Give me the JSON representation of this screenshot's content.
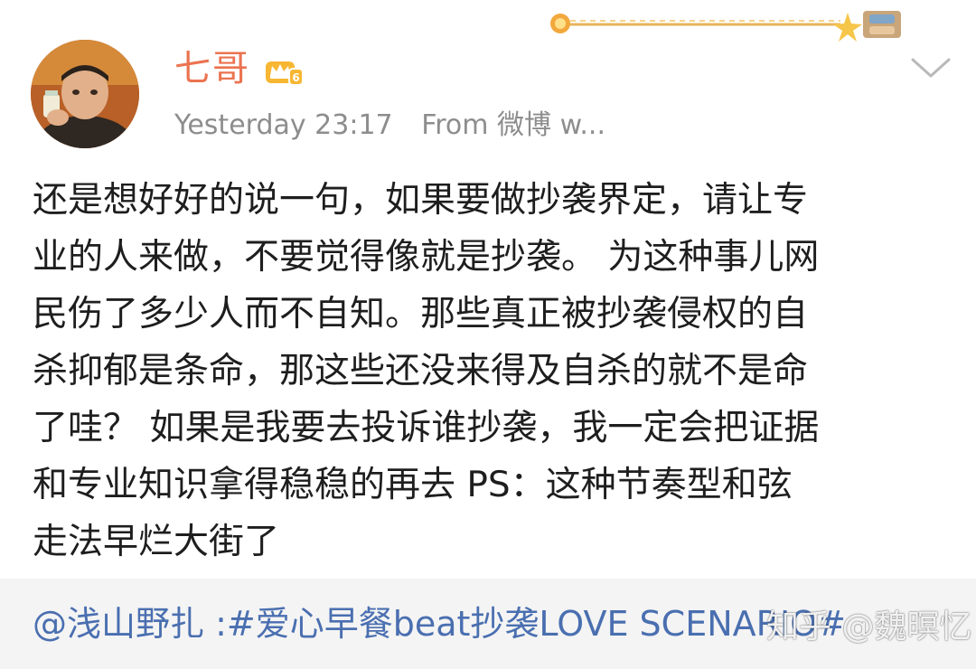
{
  "post": {
    "username": "七哥",
    "time": "Yesterday 23:17",
    "source": "From 微博 w...",
    "body": "还是想好好的说一句，如果要做抄袭界定，请让专\n业的人来做，不要觉得像就是抄袭。 为这种事儿网\n民伤了多少人而不自知。那些真正被抄袭侵权的自\n杀抑郁是条命，那这些还没来得及自杀的就不是命\n了哇？ 如果是我要去投诉谁抄袭，我一定会把证据\n和专业知识拿得稳稳的再去 PS：这种节奏型和弦\n走法早烂大街了",
    "icons": {
      "avatar": "avatar",
      "vip": "vip-crown-icon",
      "menu": "chevron-down-icon",
      "decoration": "card-decoration"
    }
  },
  "repost": {
    "text": "@浅山野扎 :#爱心早餐beat抄袭LOVE SCENARIO#"
  },
  "watermark": {
    "text": "知乎 @魏暝忆"
  },
  "colors": {
    "username": "#eb7350",
    "meta": "#8d8d8d",
    "body": "#1e1e1e",
    "link": "#4a6fb0",
    "repost_bg": "#f4f4f4"
  }
}
